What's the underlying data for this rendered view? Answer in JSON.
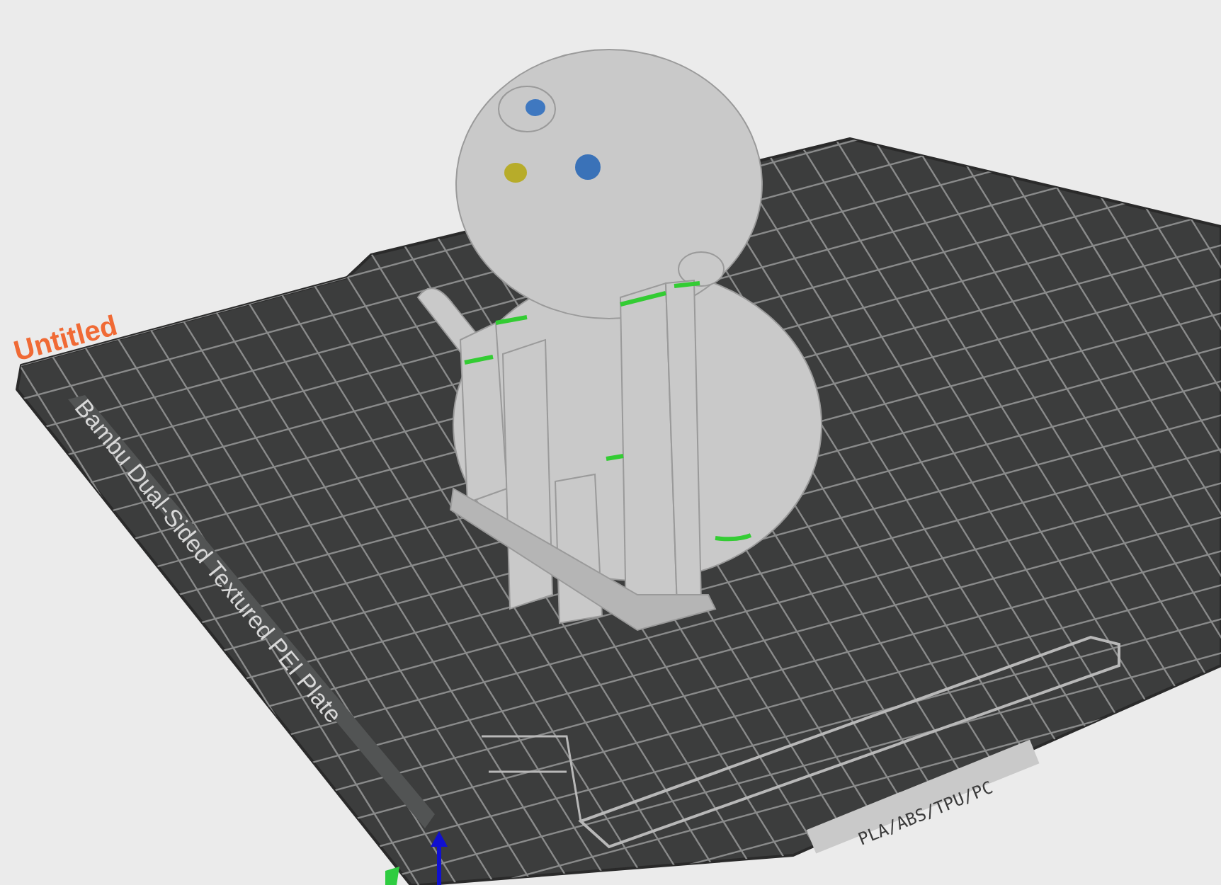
{
  "viewport": {
    "project_title": "Untitled",
    "plate": {
      "name": "Bambu Dual-Sided Textured PEI Plate",
      "filament_label": "PLA/ABS/TPU/PC"
    }
  }
}
